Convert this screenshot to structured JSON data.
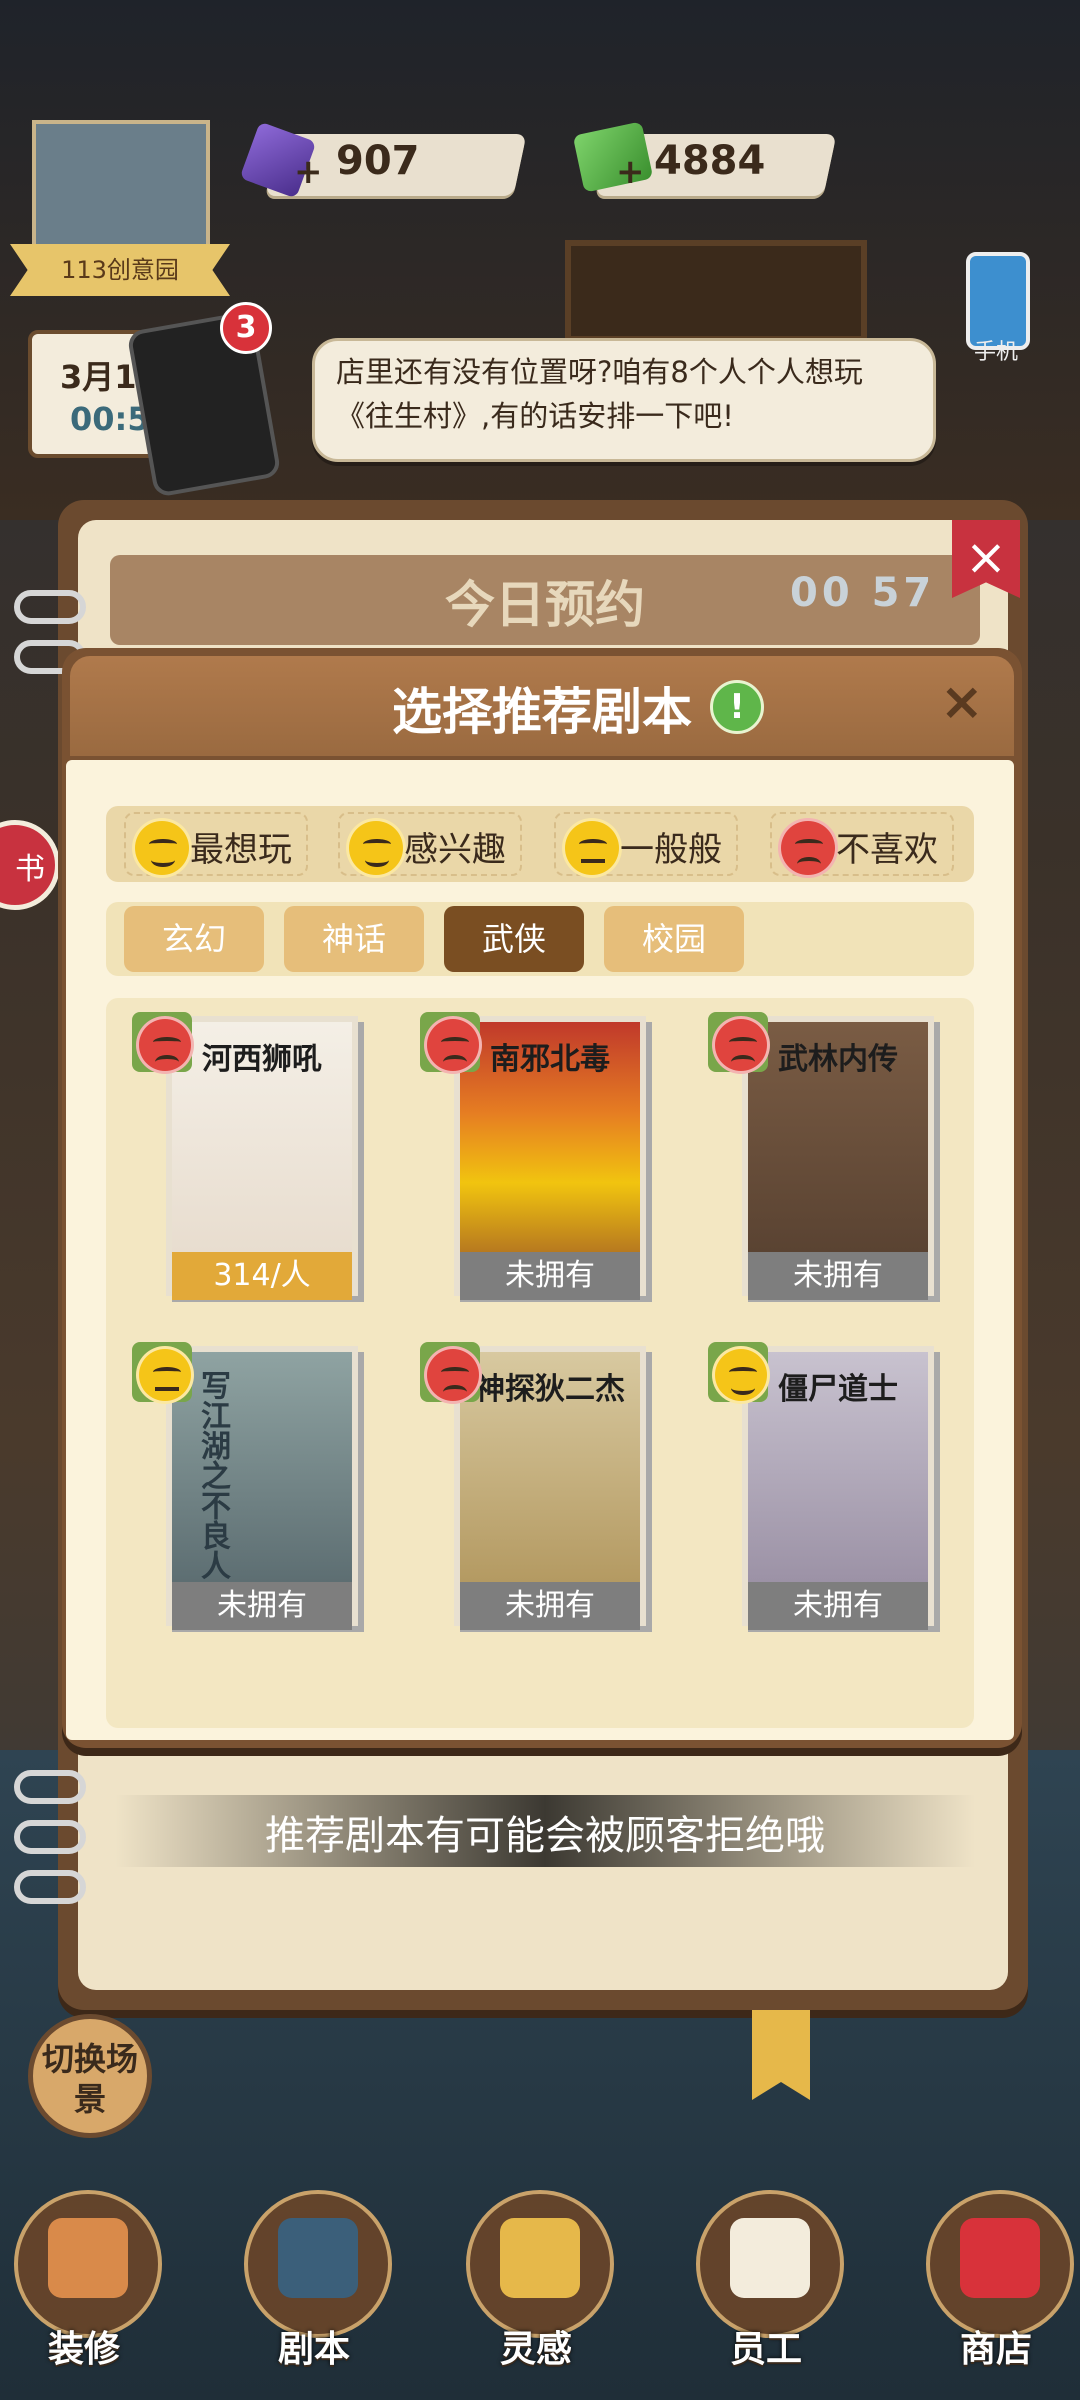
{
  "hud": {
    "gems": "907",
    "cash": "4884",
    "plus_symbol": "+"
  },
  "shop_card": {
    "name": "113创意园"
  },
  "calendar": {
    "date": "3月13",
    "time": "00:57"
  },
  "phone": {
    "badge": "3",
    "side_label": "手机"
  },
  "side_button": {
    "label": "书"
  },
  "speech_bubble": {
    "text": "店里还有没有位置呀?咱有8个人个人想玩《往生村》,有的话安排一下吧!"
  },
  "notebook": {
    "title": "今日预约",
    "timer": "00 57",
    "close": "×",
    "hint": "推荐剧本有可能会被顾客拒绝哦"
  },
  "dialog": {
    "title": "选择推荐剧本",
    "info_icon": "!",
    "close": "×",
    "legend": [
      {
        "label": "最想玩",
        "mood": "love",
        "color": "#f5c518"
      },
      {
        "label": "感兴趣",
        "mood": "interested",
        "color": "#f5c518"
      },
      {
        "label": "一般般",
        "mood": "neutral",
        "color": "#f5c518"
      },
      {
        "label": "不喜欢",
        "mood": "dislike",
        "color": "#e0443e"
      }
    ],
    "tabs": [
      {
        "label": "玄幻",
        "active": false
      },
      {
        "label": "神话",
        "active": false
      },
      {
        "label": "武侠",
        "active": true
      },
      {
        "label": "校园",
        "active": false
      }
    ],
    "scripts": [
      {
        "title": "河西狮吼",
        "status": "314/人",
        "owned": true,
        "mood": "dislike"
      },
      {
        "title": "南邪北毒",
        "status": "未拥有",
        "owned": false,
        "mood": "dislike"
      },
      {
        "title": "武林内传",
        "status": "未拥有",
        "owned": false,
        "mood": "dislike"
      },
      {
        "title": "写江湖之不良人",
        "status": "未拥有",
        "owned": false,
        "mood": "neutral"
      },
      {
        "title": "神探狄二杰",
        "status": "未拥有",
        "owned": false,
        "mood": "dislike"
      },
      {
        "title": "僵尸道士",
        "status": "未拥有",
        "owned": false,
        "mood": "interested"
      }
    ]
  },
  "switch_scene": "切换场景",
  "bottom_nav": [
    {
      "label": "装修",
      "icon": "house-icon"
    },
    {
      "label": "剧本",
      "icon": "script-book-icon"
    },
    {
      "label": "灵感",
      "icon": "lightbulb-icon"
    },
    {
      "label": "员工",
      "icon": "staff-card-icon"
    },
    {
      "label": "商店",
      "icon": "shop-icon"
    }
  ],
  "colors": {
    "accent_brown": "#7a4e22",
    "dislike_red": "#e0443e",
    "like_yellow": "#f5c518",
    "owned_gold": "#e2a939",
    "not_owned_gray": "#7e7e7e"
  }
}
